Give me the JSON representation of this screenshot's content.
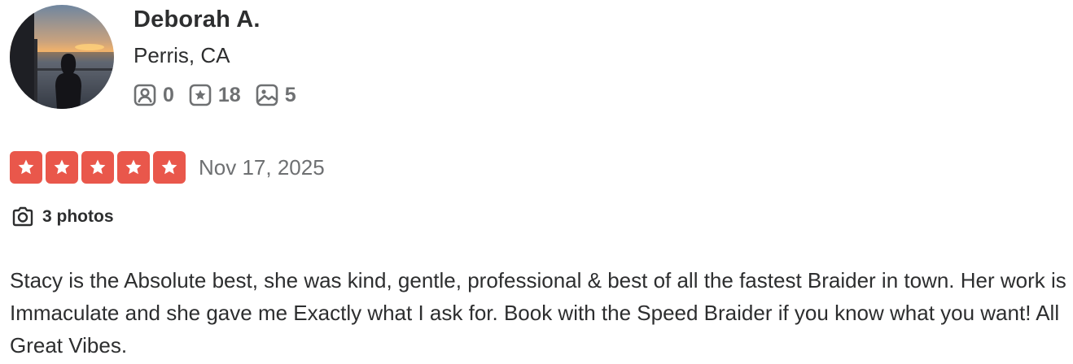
{
  "user": {
    "name": "Deborah A.",
    "location": "Perris, CA",
    "stats": [
      {
        "icon": "friends-icon",
        "value": "0"
      },
      {
        "icon": "reviews-icon",
        "value": "18"
      },
      {
        "icon": "photos-icon",
        "value": "5"
      }
    ]
  },
  "review": {
    "rating": 5,
    "rating_max": 5,
    "date": "Nov 17, 2025",
    "photos_label": "3 photos",
    "text": "Stacy is the Absolute best, she was kind, gentle, professional & best of all the fastest Braider in town. Her work is Immaculate and she gave me Exactly what I ask for. Book with the Speed Braider if you know what you want! All Great Vibes."
  },
  "colors": {
    "star": "#e9574b",
    "text": "#2d2e2f",
    "muted": "#6e7072"
  }
}
